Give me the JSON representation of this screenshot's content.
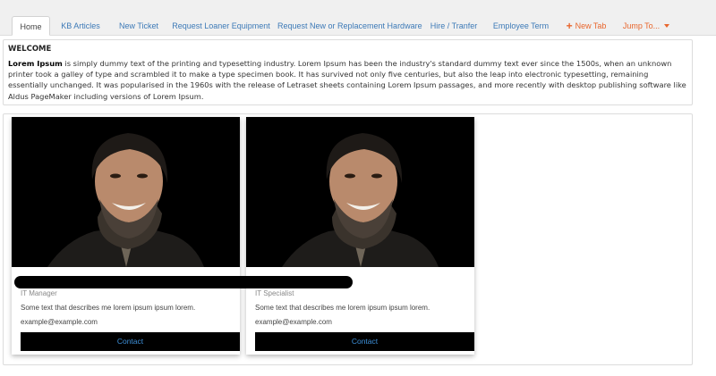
{
  "tabs": [
    {
      "label": "Home",
      "active": true
    },
    {
      "label": "KB Articles"
    },
    {
      "label": "New Ticket"
    },
    {
      "label": "Request Loaner Equipment"
    },
    {
      "label": "Request New or Replacement Hardware"
    },
    {
      "label": "Hire / Tranfer"
    },
    {
      "label": "Employee Term"
    },
    {
      "label": "New Tab",
      "icon": "plus-icon"
    },
    {
      "label": "Jump To...",
      "icon": "caret-down-icon"
    }
  ],
  "welcome": {
    "heading": "WELCOME",
    "lead": "Lorem Ipsum",
    "body": " is simply dummy text of the printing and typesetting industry. Lorem Ipsum has been the industry's standard dummy text ever since the 1500s, when an unknown printer took a galley of type and scrambled it to make a type specimen book. It has survived not only five centuries, but also the leap into electronic typesetting, remaining essentially unchanged. It was popularised in the 1960s with the release of Letraset sheets containing Lorem Ipsum passages, and more recently with desktop publishing software like Aldus PageMaker including versions of Lorem Ipsum."
  },
  "cards": [
    {
      "name": "",
      "title": "IT Manager",
      "description": "Some text that describes me lorem ipsum ipsum lorem.",
      "email": "example@example.com",
      "button": "Contact"
    },
    {
      "name": "",
      "title": "IT Specialist",
      "description": "Some text that describes me lorem ipsum ipsum lorem.",
      "email": "example@example.com",
      "button": "Contact"
    }
  ],
  "colors": {
    "link": "#3d7ab7",
    "accent": "#e8662d",
    "button_bg": "#000000",
    "button_text": "#3d8fd8"
  }
}
